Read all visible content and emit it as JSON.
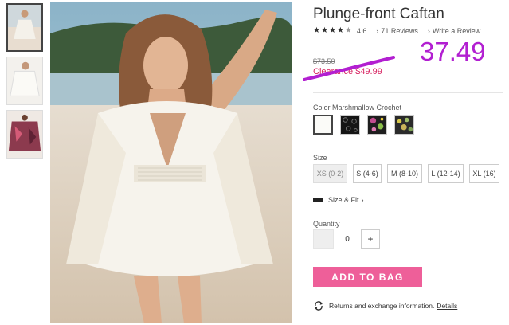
{
  "product": {
    "title": "Plunge-front Caftan",
    "rating_value": "4.6",
    "stars": 4.5,
    "reviews": "71 Reviews",
    "write_review": "Write a Review"
  },
  "price": {
    "original": "$73.50",
    "clearance": "Clearance $49.99",
    "annotation": "37.49",
    "annotation_color": "#b21fd1",
    "clearance_color": "#d6205f"
  },
  "color": {
    "label": "Color Marshmallow Crochet",
    "swatches": [
      "white-swatch",
      "black-lace-swatch",
      "floral-black-swatch",
      "floral-dark-swatch"
    ],
    "selected": 0
  },
  "size": {
    "label": "Size",
    "options": [
      "XS (0-2)",
      "S (4-6)",
      "M (8-10)",
      "L (12-14)",
      "XL (16)"
    ],
    "selected": 0,
    "fit_label": "Size & Fit"
  },
  "quantity": {
    "label": "Quantity",
    "value": "0"
  },
  "actions": {
    "add_to_bag": "ADD TO BAG",
    "add_color": "#ee5f99"
  },
  "returns": {
    "text": "Returns and exchange information.",
    "link": "Details"
  }
}
